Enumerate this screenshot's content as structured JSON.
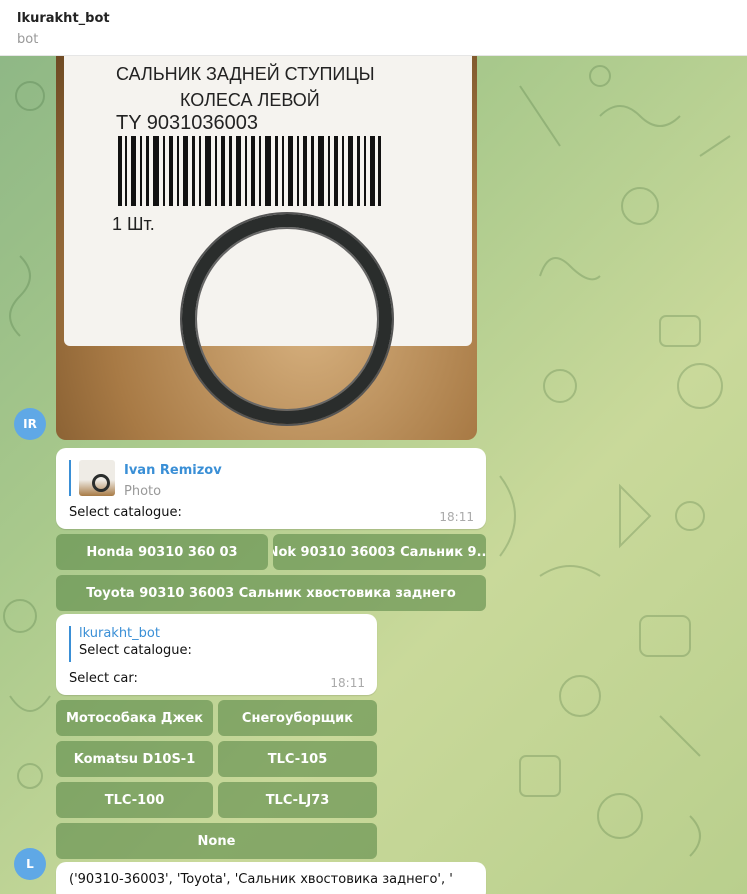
{
  "header": {
    "title": "lkurakht_bot",
    "subtitle": "bot"
  },
  "photo": {
    "label_line1": "САЛЬНИК ЗАДНЕЙ СТУПИЦЫ",
    "label_line2": "КОЛЕСА ЛЕВОЙ",
    "part_code": "TY 9031036003",
    "quantity": "1 Шт."
  },
  "avatars": {
    "user_initials": "IR",
    "bot_initial": "L"
  },
  "msg1": {
    "reply_author": "Ivan Remizov",
    "reply_type": "Photo",
    "text": "Select catalogue:",
    "time": "18:11"
  },
  "keyboard1": [
    "Honda 90310 360 03",
    "Nok 90310 36003 Сальник 9...",
    "Toyota 90310 36003 Сальник хвостовика заднего"
  ],
  "msg2": {
    "reply_author": "lkurakht_bot",
    "reply_text": "Select catalogue:",
    "text": "Select car:",
    "time": "18:11"
  },
  "keyboard2": [
    "Мотособака Джек",
    "Снегоуборщик",
    "Komatsu D10S-1",
    "TLC-105",
    "TLC-100",
    "TLC-LJ73",
    "None"
  ],
  "msg3": {
    "text": "('90310-36003', 'Toyota', 'Сальник хвостовика заднего', '"
  },
  "colors": {
    "accent": "#3a8fd6",
    "avatar": "#5fa8e6",
    "keyboard_button": "#6f9a5c"
  }
}
